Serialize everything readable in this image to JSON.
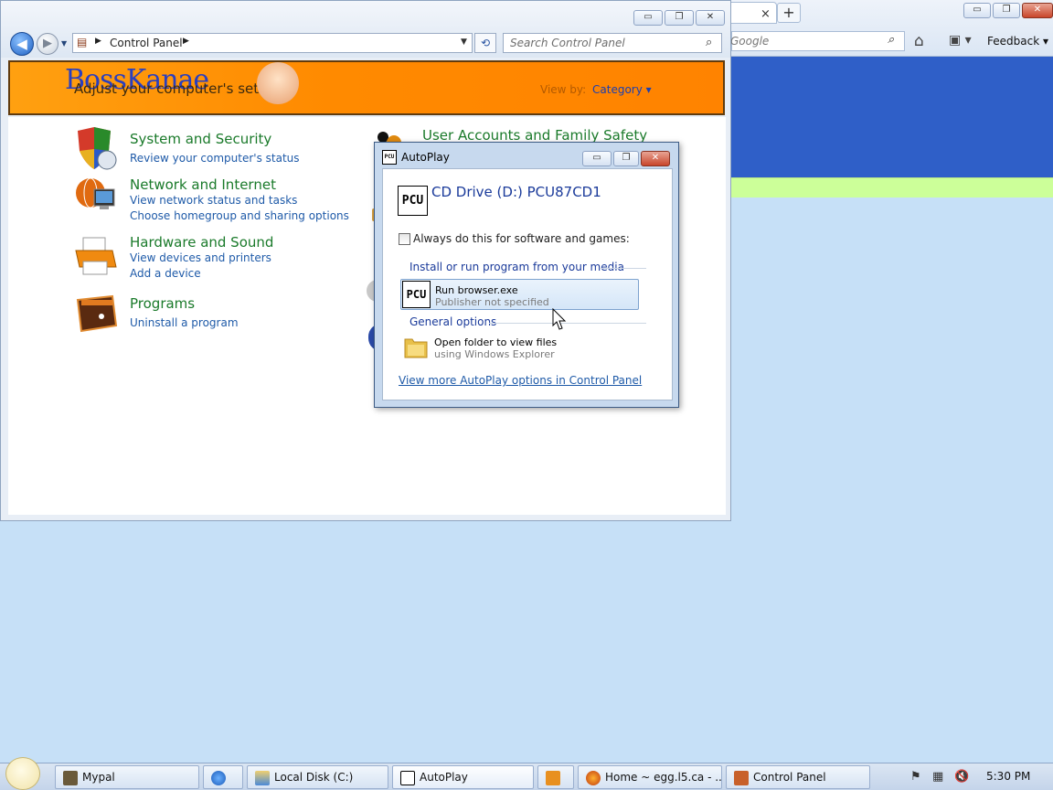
{
  "browser": {
    "tab_close": "×",
    "new_tab": "+",
    "search_placeholder": "Google",
    "feedback": "Feedback",
    "win_min": "▭",
    "win_restore": "❐",
    "win_close": "✕"
  },
  "control_panel": {
    "address": "Control Panel",
    "search_placeholder": "Search Control Panel",
    "banner_logo": "BossKanae",
    "banner_subtitle": "Adjust your computer's settings",
    "view_by_label": "View by:",
    "view_by_value": "Category ▾",
    "win_min": "▭",
    "win_restore": "❐",
    "win_close": "✕",
    "categories": [
      {
        "title": "System and Security",
        "links": [
          "Review your computer's status"
        ]
      },
      {
        "title": "Network and Internet",
        "links": [
          "View network status and tasks",
          "Choose homegroup and sharing options"
        ]
      },
      {
        "title": "Hardware and Sound",
        "links": [
          "View devices and printers",
          "Add a device"
        ]
      },
      {
        "title": "Programs",
        "links": [
          "Uninstall a program"
        ]
      }
    ],
    "right_categories": [
      {
        "title": "User Accounts and Family Safety"
      }
    ]
  },
  "autoplay": {
    "title": "AutoPlay",
    "drive_title": "CD Drive (D:) PCU87CD1",
    "always_label": "Always do this for software and games:",
    "always_checked": false,
    "section_install": "Install or run program from your media",
    "run_title": "Run browser.exe",
    "run_subtitle": "Publisher not specified",
    "section_general": "General options",
    "open_title": "Open folder to view files",
    "open_subtitle": "using Windows Explorer",
    "more_link": "View more AutoPlay options in Control Panel",
    "pcu_logo": "PCU",
    "win_min": "▭",
    "win_restore": "❐",
    "win_close": "✕"
  },
  "taskbar": {
    "items": [
      {
        "label": "Mypal",
        "icon": "mypal-icon"
      },
      {
        "label": "",
        "icon": "ie-icon"
      },
      {
        "label": "Local Disk (C:)",
        "icon": "explorer-icon"
      },
      {
        "label": "AutoPlay",
        "icon": "autoplay-icon"
      },
      {
        "label": "",
        "icon": "media-icon"
      },
      {
        "label": "Home ~ egg.l5.ca - ...",
        "icon": "firefox-icon"
      },
      {
        "label": "Control Panel",
        "icon": "control-panel-icon"
      }
    ],
    "clock": "5:30 PM"
  },
  "colors": {
    "banner_orange": "#ff8a00",
    "category_green": "#1a7a2a",
    "link_blue": "#1e5aa8",
    "browser_blue": "#2f5fc8",
    "browser_green": "#ccff99",
    "desktop": "#c6e0f7"
  }
}
